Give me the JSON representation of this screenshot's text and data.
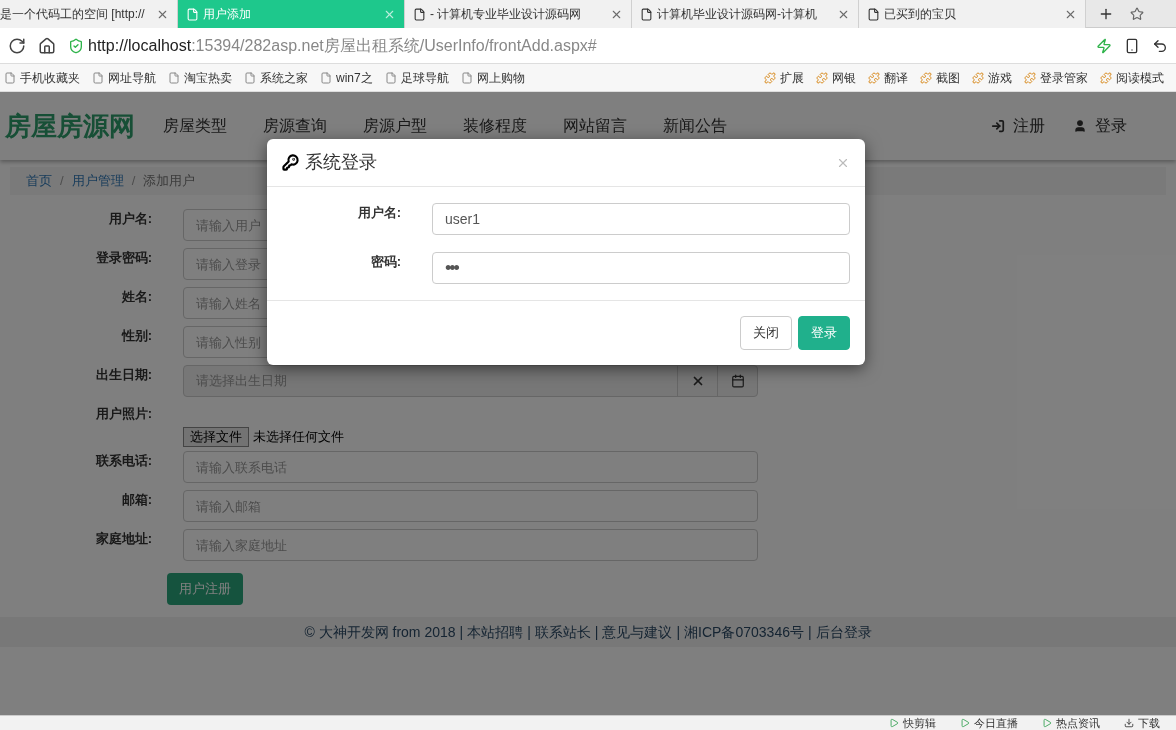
{
  "browser": {
    "tabs": [
      {
        "title": "是一个代码工的空间 [http://",
        "selected": false
      },
      {
        "title": "用户添加",
        "selected": true
      },
      {
        "title": "- 计算机专业毕业设计源码网",
        "selected": false
      },
      {
        "title": "计算机毕业设计源码网-计算机",
        "selected": false
      },
      {
        "title": "已买到的宝贝",
        "selected": false
      }
    ],
    "address": {
      "host": "http://localhost",
      "rest": ":15394/282asp.net房屋出租系统/UserInfo/frontAdd.aspx#"
    },
    "bookmarks": [
      "手机收藏夹",
      "网址导航",
      "淘宝热卖",
      "系统之家",
      "win7之",
      "足球导航",
      "网上购物"
    ],
    "tools": [
      "扩展",
      "网银",
      "翻译",
      "截图",
      "游戏",
      "登录管家",
      "阅读模式"
    ],
    "status_items": [
      "快剪辑",
      "今日直播",
      "热点资讯",
      "下载"
    ]
  },
  "site": {
    "logo": "房屋房源网",
    "nav": [
      "房屋类型",
      "房源查询",
      "房源户型",
      "装修程度",
      "网站留言",
      "新闻公告"
    ],
    "auth_links": [
      {
        "label": "注册",
        "kind": "register"
      },
      {
        "label": "登录",
        "kind": "login"
      }
    ],
    "breadcrumb_separator": "/",
    "breadcrumb": [
      {
        "label": "首页",
        "kind": "link"
      },
      {
        "label": "用户管理",
        "kind": "link"
      },
      {
        "label": "添加用户",
        "kind": "current"
      }
    ],
    "form": {
      "fields": [
        {
          "label": "用户名:",
          "kind": "text",
          "placeholder": "请输入用户"
        },
        {
          "label": "登录密码:",
          "kind": "text",
          "placeholder": "请输入登录"
        },
        {
          "label": "姓名:",
          "kind": "text",
          "placeholder": "请输入姓名"
        },
        {
          "label": "性别:",
          "kind": "text",
          "placeholder": "请输入性别"
        },
        {
          "label": "出生日期:",
          "kind": "date",
          "placeholder": "请选择出生日期"
        },
        {
          "label": "用户照片:",
          "kind": "file",
          "button": "选择文件",
          "status": "未选择任何文件"
        },
        {
          "label": "联系电话:",
          "kind": "text",
          "placeholder": "请输入联系电话"
        },
        {
          "label": "邮箱:",
          "kind": "text",
          "placeholder": "请输入邮箱"
        },
        {
          "label": "家庭地址:",
          "kind": "text",
          "placeholder": "请输入家庭地址"
        }
      ],
      "submit": "用户注册"
    },
    "footer": {
      "separator": "|",
      "copyright": "© 大神开发网 from 2018",
      "links": [
        "本站招聘",
        "联系站长",
        "意见与建议",
        "湘ICP备0703346号",
        "后台登录"
      ]
    }
  },
  "modal": {
    "title": "系统登录",
    "fields": [
      {
        "label": "用户名:",
        "kind": "text",
        "value": "user1"
      },
      {
        "label": "密码:",
        "kind": "password",
        "value": "•••"
      }
    ],
    "buttons": [
      {
        "label": "关闭",
        "kind": "default"
      },
      {
        "label": "登录",
        "kind": "primary"
      }
    ]
  }
}
